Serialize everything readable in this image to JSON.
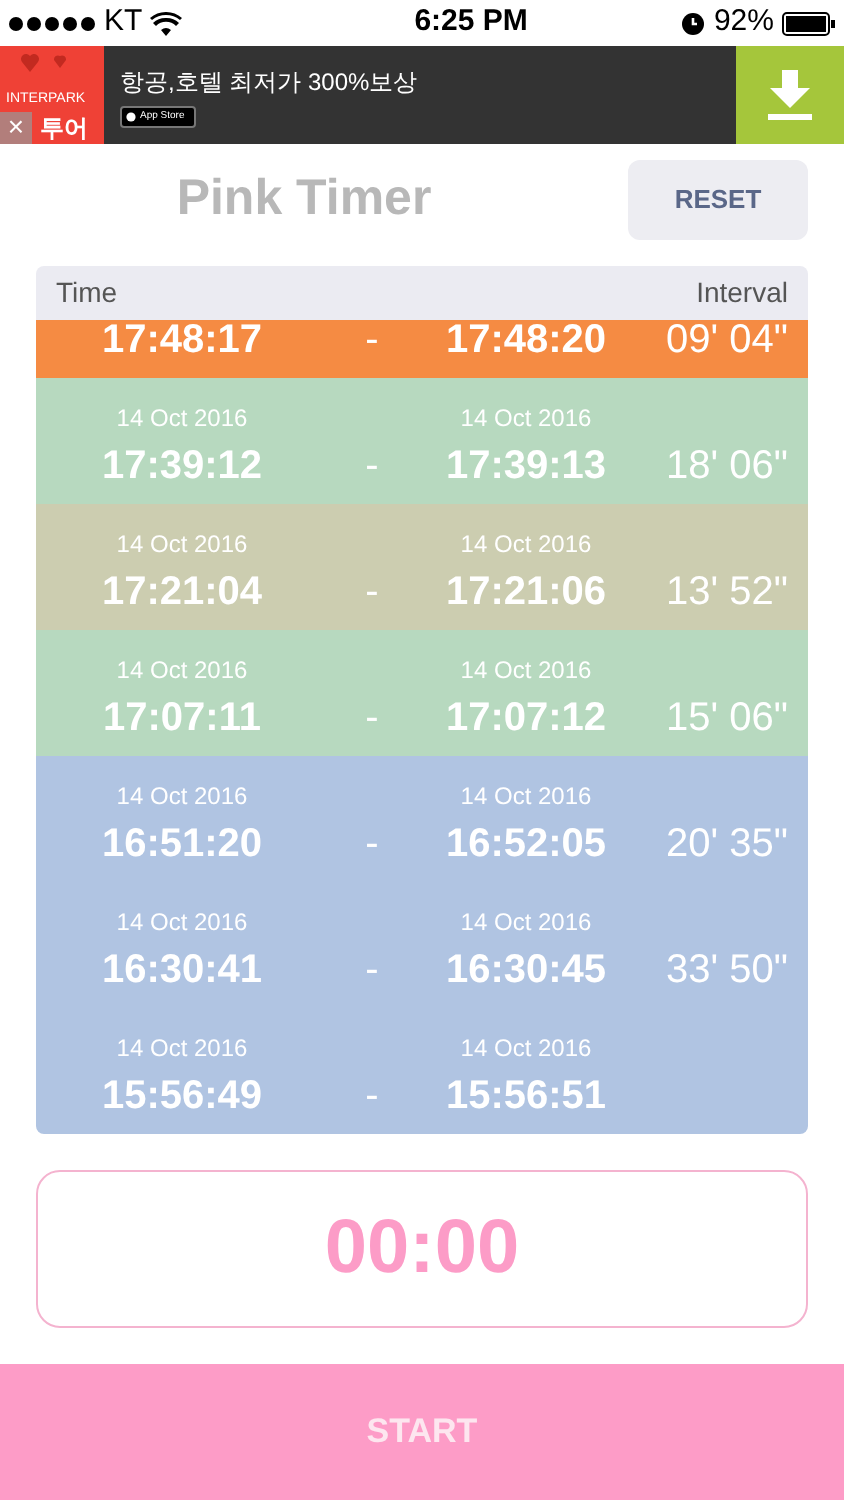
{
  "status_bar": {
    "carrier": "KT",
    "time": "6:25 PM",
    "battery": "92%"
  },
  "ad": {
    "logo_top": "INTERPARK",
    "logo_bottom": "투어",
    "close": "×",
    "headline": "항공,호텔 최저가 300%보상",
    "store_badge": "App Store"
  },
  "header": {
    "title": "Pink Timer",
    "reset": "RESET"
  },
  "table": {
    "columns": [
      "Time",
      "Interval"
    ],
    "rows": [
      {
        "start": "17:48:17",
        "separator": "-",
        "end": "17:48:20",
        "interval": "09' 04\"",
        "color": "#f58b43"
      },
      {
        "start_date": "14 Oct 2016",
        "start": "17:39:12",
        "separator": "-",
        "end_date": "14 Oct 2016",
        "end": "17:39:13",
        "interval": "18' 06\"",
        "color": "#b7d9bf"
      },
      {
        "start_date": "14 Oct 2016",
        "start": "17:21:04",
        "separator": "-",
        "end_date": "14 Oct 2016",
        "end": "17:21:06",
        "interval": "13' 52\"",
        "color": "#cccdb0"
      },
      {
        "start_date": "14 Oct 2016",
        "start": "17:07:11",
        "separator": "-",
        "end_date": "14 Oct 2016",
        "end": "17:07:12",
        "interval": "15' 06\"",
        "color": "#b7d9bf"
      },
      {
        "start_date": "14 Oct 2016",
        "start": "16:51:20",
        "separator": "-",
        "end_date": "14 Oct 2016",
        "end": "16:52:05",
        "interval": "20' 35\"",
        "color": "#b0c4e2"
      },
      {
        "start_date": "14 Oct 2016",
        "start": "16:30:41",
        "separator": "-",
        "end_date": "14 Oct 2016",
        "end": "16:30:45",
        "interval": "33' 50\"",
        "color": "#b0c4e2"
      },
      {
        "start_date": "14 Oct 2016",
        "start": "15:56:49",
        "separator": "-",
        "end_date": "14 Oct 2016",
        "end": "15:56:51",
        "color": "#b0c4e2"
      }
    ]
  },
  "timer": "00:00",
  "start_button": "START"
}
